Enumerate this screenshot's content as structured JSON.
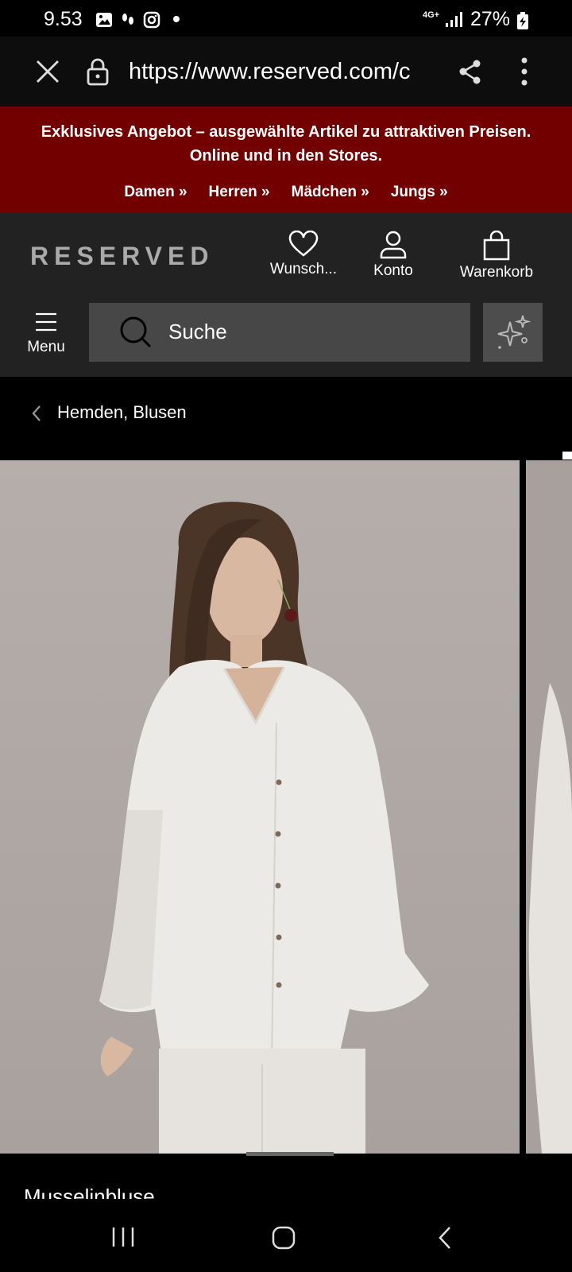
{
  "status_bar": {
    "time": "9.53",
    "network": "4G+",
    "battery": "27%"
  },
  "browser": {
    "url": "https://www.reserved.com/c"
  },
  "promo": {
    "text": "Exklusives Angebot – ausgewählte Artikel zu attraktiven Preisen. Online und in den Stores.",
    "links": [
      "Damen »",
      "Herren »",
      "Mädchen »",
      "Jungs »"
    ]
  },
  "header": {
    "logo": "RESERVED",
    "wishlist_label": "Wunsch...",
    "account_label": "Konto",
    "cart_label": "Warenkorb"
  },
  "search": {
    "menu_label": "Menu",
    "placeholder": "Suche"
  },
  "breadcrumb": {
    "label": "Hemden, Blusen"
  },
  "product": {
    "title": "Musselinbluse"
  },
  "colors": {
    "promo_bg": "#720000",
    "header_bg": "#222222"
  }
}
